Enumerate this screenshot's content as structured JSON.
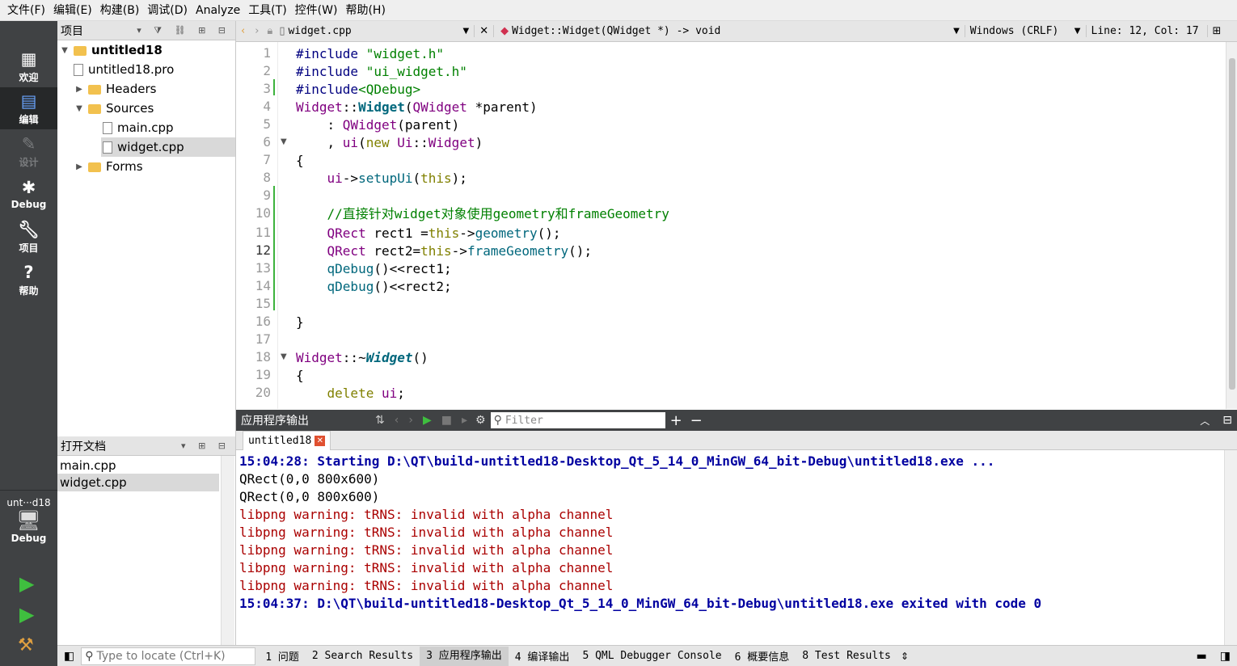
{
  "menu": [
    "文件(F)",
    "编辑(E)",
    "构建(B)",
    "调试(D)",
    "Analyze",
    "工具(T)",
    "控件(W)",
    "帮助(H)"
  ],
  "modes": [
    {
      "label": "欢迎",
      "icon": "grid-icon"
    },
    {
      "label": "编辑",
      "icon": "edit-icon"
    },
    {
      "label": "设计",
      "icon": "pen-icon"
    },
    {
      "label": "Debug",
      "icon": "bug-icon"
    },
    {
      "label": "项目",
      "icon": "wrench-icon"
    },
    {
      "label": "帮助",
      "icon": "help-icon"
    }
  ],
  "target": {
    "name": "unt···d18",
    "mode": "Debug"
  },
  "project_panel": {
    "title": "项目"
  },
  "tree": [
    {
      "label": "untitled18",
      "type": "project"
    },
    {
      "label": "untitled18.pro",
      "type": "file"
    },
    {
      "label": "Headers",
      "type": "folder"
    },
    {
      "label": "Sources",
      "type": "folder"
    },
    {
      "label": "main.cpp",
      "type": "file"
    },
    {
      "label": "widget.cpp",
      "type": "file"
    },
    {
      "label": "Forms",
      "type": "folder"
    }
  ],
  "open_docs": {
    "title": "打开文档",
    "items": [
      "main.cpp",
      "widget.cpp"
    ]
  },
  "editor": {
    "file": "widget.cpp",
    "symbol": "Widget::Widget(QWidget *) -> void",
    "encoding": "Windows (CRLF)",
    "position": "Line: 12, Col: 17",
    "line_numbers": [
      "1",
      "2",
      "3",
      "4",
      "5",
      "6",
      "7",
      "8",
      "9",
      "10",
      "11",
      "12",
      "13",
      "14",
      "15",
      "16",
      "17",
      "18",
      "19",
      "20"
    ]
  },
  "output": {
    "title": "应用程序输出",
    "filter_placeholder": "Filter",
    "tab": "untitled18",
    "lines": [
      {
        "text": "15:04:28: Starting D:\\QT\\build-untitled18-Desktop_Qt_5_14_0_MinGW_64_bit-Debug\\untitled18.exe ...",
        "kind": "info"
      },
      {
        "text": "QRect(0,0 800x600)",
        "kind": "normal"
      },
      {
        "text": "QRect(0,0 800x600)",
        "kind": "normal"
      },
      {
        "text": "libpng warning: tRNS: invalid with alpha channel",
        "kind": "err"
      },
      {
        "text": "libpng warning: tRNS: invalid with alpha channel",
        "kind": "err"
      },
      {
        "text": "libpng warning: tRNS: invalid with alpha channel",
        "kind": "err"
      },
      {
        "text": "libpng warning: tRNS: invalid with alpha channel",
        "kind": "err"
      },
      {
        "text": "libpng warning: tRNS: invalid with alpha channel",
        "kind": "err"
      },
      {
        "text": "15:04:37: D:\\QT\\build-untitled18-Desktop_Qt_5_14_0_MinGW_64_bit-Debug\\untitled18.exe exited with code 0",
        "kind": "info"
      }
    ]
  },
  "statusbar": {
    "locate_placeholder": "Type to locate (Ctrl+K)",
    "panes": [
      "1 问题",
      "2 Search Results",
      "3 应用程序输出",
      "4 编译输出",
      "5 QML Debugger Console",
      "6 概要信息",
      "8 Test Results"
    ]
  }
}
